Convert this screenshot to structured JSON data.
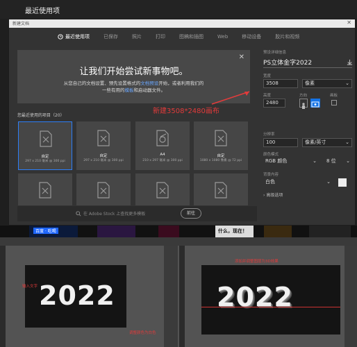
{
  "page": {
    "heading": "最近使用项"
  },
  "dialog": {
    "title": "新建文档",
    "tabs": [
      {
        "label": "最近使用项",
        "active": true
      },
      {
        "label": "已保存"
      },
      {
        "label": "照片"
      },
      {
        "label": "打印"
      },
      {
        "label": "图稿和插图"
      },
      {
        "label": "Web"
      },
      {
        "label": "移动设备"
      },
      {
        "label": "胶片和视频"
      }
    ],
    "promo": {
      "heading": "让我们开始尝试新事物吧。",
      "line1_a": "从您自己的文档设置、预先设置格式的",
      "line1_link": "文档预设",
      "line1_b": "开始，或者利用我们的",
      "line2_a": "一些有用的",
      "line2_link": "模板",
      "line2_b": "和启动器文件。"
    },
    "annotation": "新建3508*2480画布",
    "recent_label": "您最近使用的项目（20）",
    "recent_items": [
      {
        "name": "自定",
        "size": "297 x 210 毫米 @ 300 ppi"
      },
      {
        "name": "自定",
        "size": "297 x 210 毫米 @ 300 ppi"
      },
      {
        "name": "A4",
        "size": "210 x 297 毫米 @ 300 ppi"
      },
      {
        "name": "自定",
        "size": "1080 x 1080 像素 @ 72 ppi"
      }
    ],
    "search": {
      "placeholder": "在 Adobe Stock 上查找更多模板",
      "button": "前往"
    },
    "preset": {
      "section_label": "预设详细信息",
      "name": "PS立体金字2022",
      "width_label": "宽度",
      "width_value": "3508",
      "width_unit": "像素",
      "height_label": "高度",
      "height_value": "2480",
      "orientation_label": "方向",
      "artboard_label": "画板",
      "resolution_label": "分辨率",
      "resolution_value": "100",
      "resolution_unit": "像素/英寸",
      "colormode_label": "颜色模式",
      "colormode_value": "RGB 颜色",
      "bitdepth_value": "8 位",
      "bg_label": "背景内容",
      "bg_value": "白色",
      "advanced_label": "高级选项"
    },
    "buttons": {
      "create": "创建",
      "close": "关闭"
    }
  },
  "strip": {
    "banner_left": "百度 · 吃喝",
    "banner_right": "什么，现在！"
  },
  "bottom": {
    "left": {
      "text": "2022",
      "note": "输入文字",
      "note2": "调整颜色为白色"
    },
    "right": {
      "text": "2022",
      "note": "添加并调整图层为3D效果"
    }
  },
  "colors": {
    "accent": "#1473e6",
    "annotation": "#e23b3b"
  }
}
